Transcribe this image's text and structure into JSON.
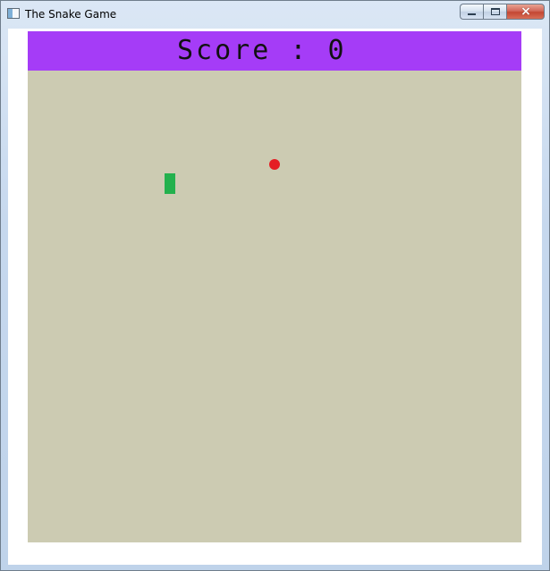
{
  "window": {
    "title": "The Snake Game"
  },
  "icons": {
    "app": "window-app-icon",
    "minimize": "minimize-icon",
    "maximize": "maximize-icon",
    "close": "close-icon"
  },
  "hud": {
    "score_label": "Score : 0"
  },
  "colors": {
    "score_bar": "#a53cf7",
    "board": "#cccbb2",
    "snake": "#23b14d",
    "food": "#e51e24",
    "client_background": "#ffffff"
  }
}
